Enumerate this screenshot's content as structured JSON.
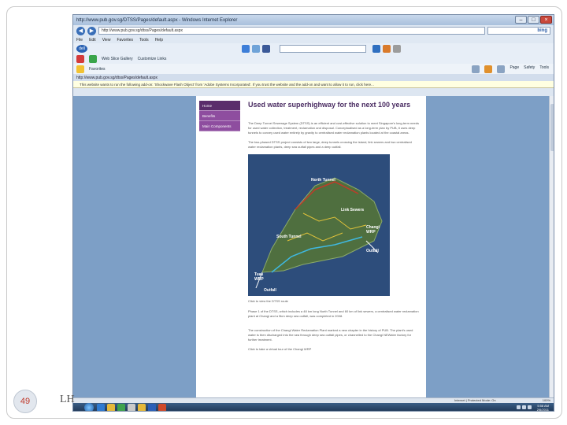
{
  "slide": {
    "page_number": "49",
    "footer_lead": "LH"
  },
  "browser": {
    "title": "http://www.pub.gov.sg/DTSS/Pages/default.aspx - Windows Internet Explorer",
    "address": "http://www.pub.gov.sg/dtss/Pages/default.aspx",
    "search_brand": "bing",
    "menu": [
      "File",
      "Edit",
      "View",
      "Favorites",
      "Tools",
      "Help"
    ],
    "links": [
      "Web Slice Gallery",
      "Customize Links"
    ],
    "favorites_label": "Favorites",
    "fav_right": [
      "Page",
      "Safety",
      "Tools"
    ],
    "tab_address": "http://www.pub.gov.sg/dtss/Pages/default.aspx",
    "infobar": "This website wants to run the following add-on: 'Shockwave Flash Object' from 'Adobe Systems Incorporated'. If you trust the website and the add-on and want to allow it to run, click here..."
  },
  "webpage": {
    "nav": [
      "Home",
      "Benefits",
      "Main Components"
    ],
    "title": "Used water superhighway for the next 100 years",
    "paragraphs": [
      "The Deep Tunnel Sewerage System (DTSS) is an efficient and cost-effective solution to meet Singapore's long-term needs for used water collection, treatment, reclamation and disposal. Conceptualised as a long-term plan by PUB, it uses deep tunnels to convey used water entirely by gravity to centralised water reclamation plants located at the coastal areas.",
      "The two-phased DTSS project consists of two large, deep tunnels crossing the island, link sewers and two centralised water reclamation plants, deep sea outfall pipes and a deep outfall.",
      "Phase 1 of the DTSS, which includes a 48 km long North Tunnel and 60 km of link sewers, a centralised water reclamation plant at Changi and a 5km deep sea outfall, was completed in 2008.",
      "The construction of the Changi Water Reclamation Plant marked a new chapter in the history of PUB. The plant's used water is then discharged into the sea through deep sea outfall pipes, or channelled to the Changi NEWater factory for further treatment."
    ],
    "map": {
      "labels": [
        "North Tunnel",
        "Link Sewers",
        "South Tunnel",
        "Changi WRP",
        "Outfall",
        "Tuas WRP",
        "Outfall"
      ]
    },
    "caption": "Click to view the DTSS route",
    "caption2": "Click to take a virtual tour of the Changi WRP"
  },
  "statusbar": {
    "zone": "Internet | Protected Mode: On",
    "zoom": "100%"
  },
  "taskbar": {
    "time": "5:58 AM",
    "date": "2/6/2011"
  }
}
